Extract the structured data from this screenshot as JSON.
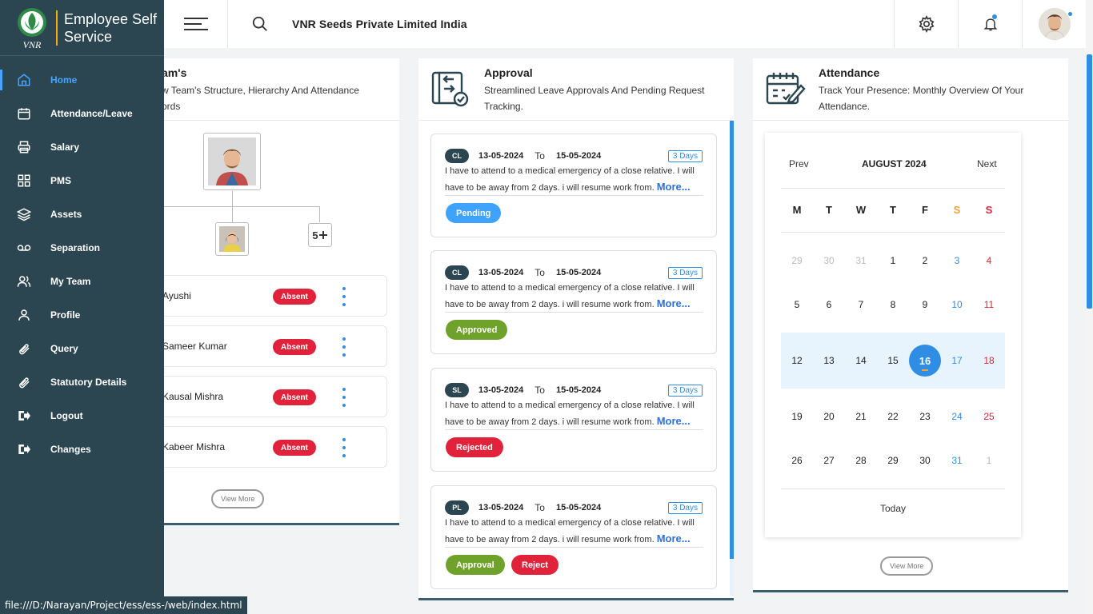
{
  "app": {
    "brand_line1": "Employee Self",
    "brand_line2": "Service",
    "logo_text": "VNR",
    "company": "VNR Seeds Private Limited India"
  },
  "sidebar": {
    "items": [
      {
        "label": "Home",
        "icon": "home-icon",
        "active": true
      },
      {
        "label": "Attendance/Leave",
        "icon": "calendar-icon"
      },
      {
        "label": "Salary",
        "icon": "printer-icon"
      },
      {
        "label": "PMS",
        "icon": "grid-icon"
      },
      {
        "label": "Assets",
        "icon": "layers-icon"
      },
      {
        "label": "Separation",
        "icon": "voicemail-icon"
      },
      {
        "label": "My Team",
        "icon": "users-icon"
      },
      {
        "label": "Profile",
        "icon": "user-icon"
      },
      {
        "label": "Query",
        "icon": "paperclip-icon"
      },
      {
        "label": "Statutory Details",
        "icon": "paperclip-icon"
      },
      {
        "label": "Logout",
        "icon": "logout-icon"
      },
      {
        "label": "Changes",
        "icon": "logout-icon"
      }
    ]
  },
  "team": {
    "title": "am's",
    "subtitle_line1": "w Team's Structure, Hierarchy And Attendance",
    "subtitle_line2": "ords",
    "more_count": "5",
    "members": [
      {
        "name": "Ayushi",
        "status": "Absent"
      },
      {
        "name": "Sameer Kumar",
        "status": "Absent"
      },
      {
        "name": "Kausal Mishra",
        "status": "Absent"
      },
      {
        "name": "Kabeer Mishra",
        "status": "Absent"
      }
    ],
    "view_more": "View More"
  },
  "approval": {
    "title": "Approval",
    "subtitle_line1": "Streamlined Leave Approvals And Pending Request",
    "subtitle_line2": "Tracking.",
    "requests": [
      {
        "type": "CL",
        "from": "13-05-2024",
        "to_label": "To",
        "to": "15-05-2024",
        "days": "3 Days",
        "reason": "I have to attend to a medical emergency of a close relative. I will have to be away from 2 days. i will resume work from.",
        "more": "More...",
        "status": "Pending"
      },
      {
        "type": "CL",
        "from": "13-05-2024",
        "to_label": "To",
        "to": "15-05-2024",
        "days": "3 Days",
        "reason": "I have to attend to a medical emergency of a close relative. I will have to be away from 2 days. i will resume work from.",
        "more": "More...",
        "status": "Approved"
      },
      {
        "type": "SL",
        "from": "13-05-2024",
        "to_label": "To",
        "to": "15-05-2024",
        "days": "3 Days",
        "reason": "I have to attend to a medical emergency of a close relative. I will have to be away from 2 days. i will resume work from.",
        "more": "More...",
        "status": "Rejected"
      },
      {
        "type": "PL",
        "from": "13-05-2024",
        "to_label": "To",
        "to": "15-05-2024",
        "days": "3 Days",
        "reason": "I have to attend to a medical emergency of a close relative. I will have to be away from 2 days. i will resume work from.",
        "more": "More...",
        "approve_label": "Approval",
        "reject_label": "Reject"
      }
    ]
  },
  "attendance": {
    "title": "Attendance",
    "subtitle_line1": "Track Your Presence: Monthly Overview Of Your",
    "subtitle_line2": "Attendance.",
    "calendar": {
      "prev": "Prev",
      "month": "AUGUST 2024",
      "next": "Next",
      "weekdays": [
        "M",
        "T",
        "W",
        "T",
        "F",
        "S",
        "S"
      ],
      "weeks": [
        [
          "29",
          "30",
          "31",
          "1",
          "2",
          "3",
          "4"
        ],
        [
          "5",
          "6",
          "7",
          "8",
          "9",
          "10",
          "11"
        ],
        [
          "12",
          "13",
          "14",
          "15",
          "16",
          "17",
          "18"
        ],
        [
          "19",
          "20",
          "21",
          "22",
          "23",
          "24",
          "25"
        ],
        [
          "26",
          "27",
          "28",
          "29",
          "30",
          "31",
          "1"
        ]
      ],
      "today": "16",
      "today_label": "Today"
    },
    "view_more": "View More"
  },
  "statusbar": {
    "url": "file:///D:/Narayan/Project/ess/ess-/web/index.html"
  },
  "colors": {
    "sidebar_bg": "#2b4650",
    "accent": "#2f8de4",
    "absent": "#e0223a",
    "approved": "#6ea22a",
    "pending": "#3fa2ff",
    "weekend_sat": "#f2a13b",
    "weekend_sun": "#e0223a"
  }
}
